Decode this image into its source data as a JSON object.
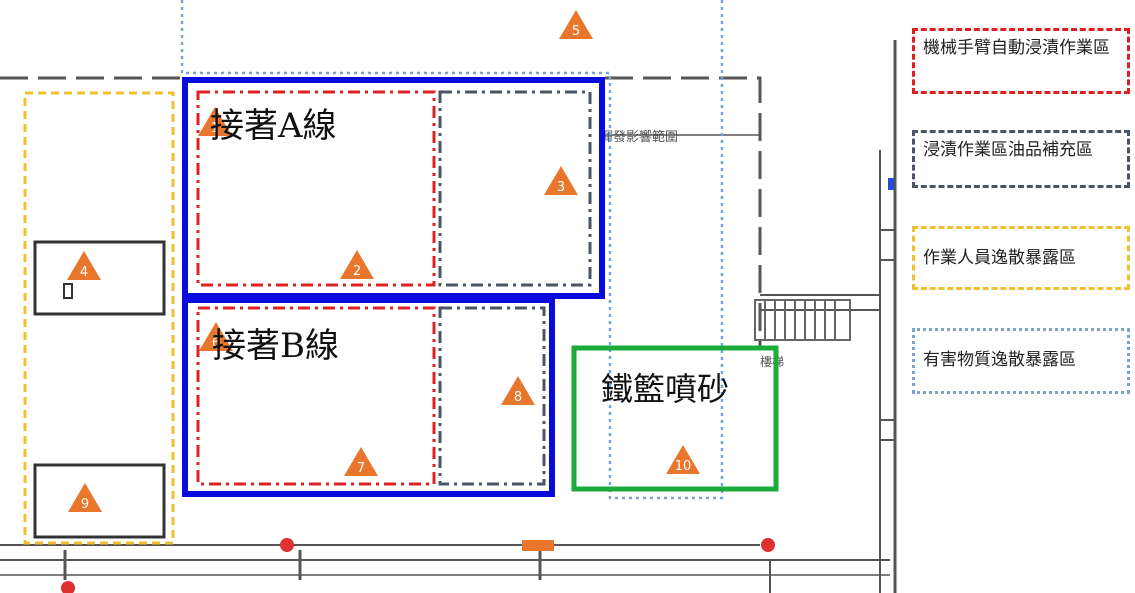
{
  "zones": {
    "line_a": "接著A線",
    "line_b": "接著B線",
    "sandblast": "鐵籃噴砂"
  },
  "plan_texts": {
    "exposure_range": "揮發影響範圍",
    "stairs": "樓梯"
  },
  "markers": [
    "1",
    "2",
    "3",
    "4",
    "5",
    "6",
    "7",
    "8",
    "9",
    "10"
  ],
  "legend": {
    "robot_dip": "機械手臂自動浸漬作業區",
    "oil_refill": "浸漬作業區油品補充區",
    "worker_exposure": "作業人員逸散暴露區",
    "hazard_exposure": "有害物質逸散暴露區"
  },
  "colors": {
    "blue_line": "#0a0adc",
    "red_dash": "#e02020",
    "grey_dash": "#4a5566",
    "yellow_dash": "#f0c030",
    "light_blue_dot": "#7aa3cf",
    "green_box": "#1aab3a",
    "marker_fill": "#e8762d"
  }
}
